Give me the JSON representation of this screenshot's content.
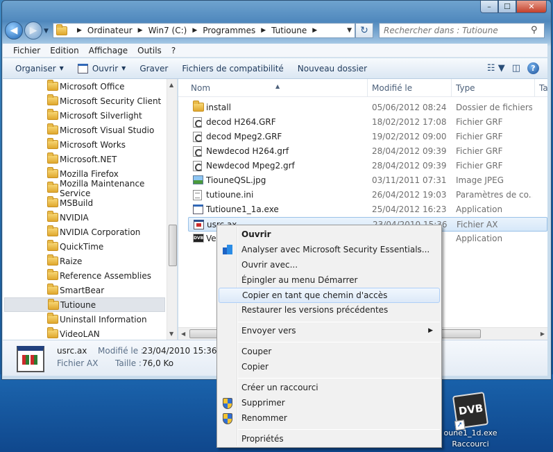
{
  "window": {
    "minimize": "–",
    "maximize": "☐",
    "close": "✕"
  },
  "address": {
    "crumbs": [
      "Ordinateur",
      "Win7 (C:)",
      "Programmes",
      "Tutioune"
    ],
    "search_placeholder": "Rechercher dans : Tutioune"
  },
  "menubar": [
    "Fichier",
    "Edition",
    "Affichage",
    "Outils",
    "?"
  ],
  "toolbar": {
    "organize": "Organiser",
    "open": "Ouvrir",
    "burn": "Graver",
    "compat": "Fichiers de compatibilité",
    "new_folder": "Nouveau dossier"
  },
  "tree": [
    "Microsoft Office",
    "Microsoft Security Client",
    "Microsoft Silverlight",
    "Microsoft Visual Studio",
    "Microsoft Works",
    "Microsoft.NET",
    "Mozilla Firefox",
    "Mozilla Maintenance Service",
    "MSBuild",
    "NVIDIA",
    "NVIDIA Corporation",
    "QuickTime",
    "Raize",
    "Reference Assemblies",
    "SmartBear",
    "Tutioune",
    "Uninstall Information",
    "VideoLAN"
  ],
  "columns": {
    "name": "Nom",
    "modified": "Modifié le",
    "type": "Type",
    "size": "Ta"
  },
  "files": [
    {
      "name": "install",
      "date": "05/06/2012 08:24",
      "type": "Dossier de fichiers",
      "icon": "folder-icon"
    },
    {
      "name": "decod H264.GRF",
      "date": "18/02/2012 17:08",
      "type": "Fichier GRF",
      "icon": "grf-file-icon"
    },
    {
      "name": "decod Mpeg2.GRF",
      "date": "19/02/2012 09:00",
      "type": "Fichier GRF",
      "icon": "grf-file-icon"
    },
    {
      "name": "Newdecod H264.grf",
      "date": "28/04/2012 09:39",
      "type": "Fichier GRF",
      "icon": "grf-file-icon"
    },
    {
      "name": "Newdecod Mpeg2.grf",
      "date": "28/04/2012 09:39",
      "type": "Fichier GRF",
      "icon": "grf-file-icon"
    },
    {
      "name": "TiouneQSL.jpg",
      "date": "03/11/2011 07:31",
      "type": "Image JPEG",
      "icon": "image-file-icon"
    },
    {
      "name": "tutioune.ini",
      "date": "26/04/2012 19:03",
      "type": "Paramètres de co...",
      "icon": "ini-file-icon"
    },
    {
      "name": "Tutioune1_1a.exe",
      "date": "25/04/2012 16:23",
      "type": "Application",
      "icon": "exe-file-icon"
    },
    {
      "name": "usrc.ax",
      "date": "23/04/2010 15:36",
      "type": "Fichier AX",
      "icon": "ax-file-icon"
    },
    {
      "name": "Ve",
      "date": "",
      "type": "Application",
      "icon": "dvb-app-icon"
    }
  ],
  "details": {
    "name": "usrc.ax",
    "type": "Fichier AX",
    "modified_label": "Modifié le :",
    "modified_value": "23/04/2010 15:36",
    "size_label": "Taille :",
    "size_value": "76,0 Ko"
  },
  "context_menu": {
    "open": "Ouvrir",
    "scan": "Analyser avec Microsoft Security Essentials...",
    "open_with": "Ouvrir avec...",
    "pin_start": "Épingler au menu Démarrer",
    "copy_path": "Copier en tant que chemin d'accès",
    "restore": "Restaurer les versions précédentes",
    "send_to": "Envoyer vers",
    "cut": "Couper",
    "copy": "Copier",
    "shortcut": "Créer un raccourci",
    "delete": "Supprimer",
    "rename": "Renommer",
    "properties": "Propriétés"
  },
  "desktop_icon": {
    "logo": "DVB",
    "line1": "oune1_1d.exe",
    "line2": "Raccourci"
  }
}
